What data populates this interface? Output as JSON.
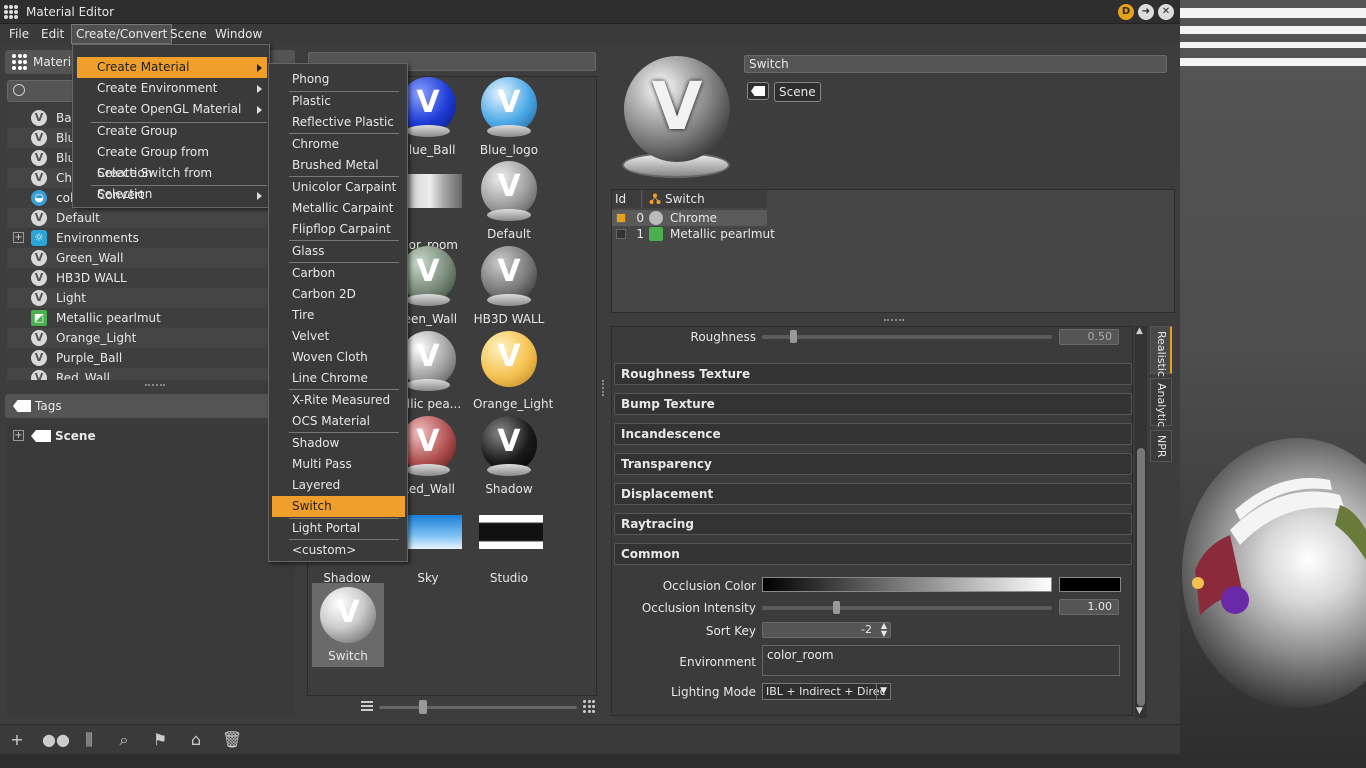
{
  "window": {
    "title": "Material Editor",
    "badge_d": "D"
  },
  "menubar": {
    "items": [
      "File",
      "Edit",
      "Create/Convert",
      "Scene",
      "Window"
    ]
  },
  "left_panel": {
    "tab_label": "Materia",
    "materials": [
      {
        "label": "Ba",
        "icon": "v-material-icon"
      },
      {
        "label": "Blu",
        "icon": "v-material-icon"
      },
      {
        "label": "Blu",
        "icon": "v-material-icon"
      },
      {
        "label": "Ch",
        "icon": "v-material-icon"
      },
      {
        "label": "col",
        "icon": "environment-icon"
      },
      {
        "label": "Default",
        "icon": "v-material-icon"
      },
      {
        "label": "Environments",
        "icon": "environments-group-icon"
      },
      {
        "label": "Green_Wall",
        "icon": "v-material-icon"
      },
      {
        "label": "HB3D WALL",
        "icon": "v-material-icon"
      },
      {
        "label": "Light",
        "icon": "v-material-icon"
      },
      {
        "label": "Metallic pearlmut",
        "icon": "metallic-carpaint-icon"
      },
      {
        "label": "Orange_Light",
        "icon": "v-material-icon"
      },
      {
        "label": "Purple_Ball",
        "icon": "v-material-icon"
      },
      {
        "label": "Red_Wall",
        "icon": "v-material-icon"
      }
    ],
    "tags_label": "Tags",
    "scene_label": "Scene"
  },
  "create_menu": {
    "items": [
      {
        "label": "Create Material",
        "submenu": true,
        "highlight": true
      },
      {
        "label": "Create Environment",
        "submenu": true
      },
      {
        "label": "Create OpenGL Material",
        "submenu": true
      },
      {
        "label": "Create Group"
      },
      {
        "label": "Create Group from Selection"
      },
      {
        "label": "Create Switch from Selection"
      },
      {
        "label": "Convert",
        "submenu": true
      }
    ]
  },
  "material_submenu": {
    "items": [
      "Phong",
      "Plastic",
      "Reflective Plastic",
      "Chrome",
      "Brushed Metal",
      "Unicolor Carpaint",
      "Metallic Carpaint",
      "Flipflop Carpaint",
      "Glass",
      "Carbon",
      "Carbon 2D",
      "Tire",
      "Velvet",
      "Woven Cloth",
      "Line Chrome",
      "X-Rite Measured",
      "OCS Material",
      "Shadow",
      "Multi Pass",
      "Layered",
      "Switch",
      "Light Portal",
      "<custom>"
    ],
    "highlighted": "Switch"
  },
  "thumbnails": [
    {
      "label": "Blue_Ball",
      "color": "#1d3bd6"
    },
    {
      "label": "Blue_logo",
      "color": "#4aa8e6"
    },
    {
      "label": "olor_room",
      "color": "env"
    },
    {
      "label": "Default",
      "color": "#9a9a9a"
    },
    {
      "label": "reen_Wall",
      "color": "#7a8a7a"
    },
    {
      "label": "HB3D WALL",
      "color": "#777777"
    },
    {
      "label": "tallic pea...",
      "color": "#a0a0a0"
    },
    {
      "label": "Orange_Light",
      "color": "#f4c150"
    },
    {
      "label": "Red_Wall",
      "color": "#b05050"
    },
    {
      "label": "Shadow",
      "color": "#1a1a1a"
    },
    {
      "label": "Shadow",
      "color": "env-white"
    },
    {
      "label": "Sky",
      "color": "env-sky"
    },
    {
      "label": "Studio",
      "color": "env-studio"
    },
    {
      "label": "Switch",
      "color": "#cccccc"
    }
  ],
  "switch_panel": {
    "name": "Switch",
    "scene_chip": "Scene",
    "columns": [
      "Id",
      "Switch"
    ],
    "rows": [
      {
        "id": "0",
        "label": "Chrome",
        "checked": true
      },
      {
        "id": "1",
        "label": "Metallic pearlmut",
        "checked": false
      }
    ]
  },
  "properties": {
    "roughness_label": "Roughness",
    "roughness_value": "0.50",
    "sections": [
      "Roughness Texture",
      "Bump Texture",
      "Incandescence",
      "Transparency",
      "Displacement",
      "Raytracing",
      "Common"
    ],
    "occlusion_color_label": "Occlusion Color",
    "occlusion_intensity_label": "Occlusion Intensity",
    "occlusion_intensity_value": "1.00",
    "sort_key_label": "Sort Key",
    "sort_key_value": "-2",
    "environment_label": "Environment",
    "environment_value": "color_room",
    "lighting_mode_label": "Lighting Mode",
    "lighting_mode_value": "IBL + Indirect + Direc"
  },
  "side_tabs": [
    "Realistic",
    "Analytic",
    "NPR"
  ],
  "colors": {
    "accent": "#f0a02a",
    "background": "#3d3d3d"
  }
}
